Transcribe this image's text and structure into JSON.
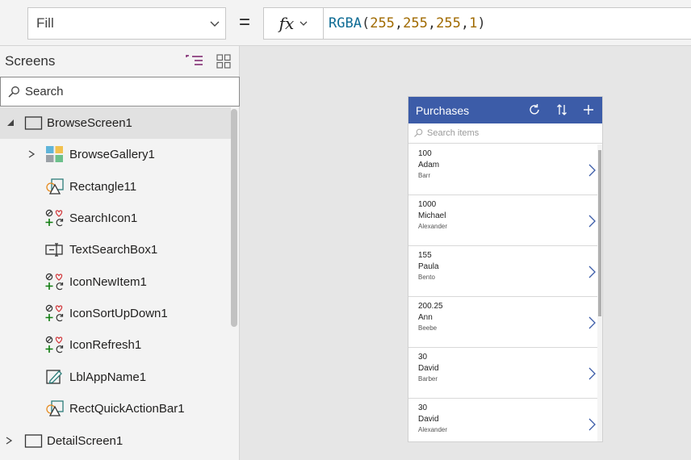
{
  "formula_bar": {
    "property": "Fill",
    "equals": "=",
    "fx_label": "fx",
    "formula_fn": "RGBA",
    "formula_args": [
      "255",
      "255",
      "255",
      "1"
    ]
  },
  "tree": {
    "header": "Screens",
    "search_placeholder": "Search",
    "items": [
      {
        "label": "BrowseScreen1",
        "icon": "screen-icon",
        "expander": "collapse"
      },
      {
        "label": "BrowseGallery1",
        "icon": "gallery-icon",
        "expander": "expand"
      },
      {
        "label": "Rectangle11",
        "icon": "shape-icon",
        "expander": ""
      },
      {
        "label": "SearchIcon1",
        "icon": "icons-control-icon",
        "expander": ""
      },
      {
        "label": "TextSearchBox1",
        "icon": "text-input-icon",
        "expander": ""
      },
      {
        "label": "IconNewItem1",
        "icon": "icons-control-icon",
        "expander": ""
      },
      {
        "label": "IconSortUpDown1",
        "icon": "icons-control-icon",
        "expander": ""
      },
      {
        "label": "IconRefresh1",
        "icon": "icons-control-icon",
        "expander": ""
      },
      {
        "label": "LblAppName1",
        "icon": "label-icon",
        "expander": ""
      },
      {
        "label": "RectQuickActionBar1",
        "icon": "shape-icon",
        "expander": ""
      },
      {
        "label": "DetailScreen1",
        "icon": "screen-icon",
        "expander": "expand"
      }
    ]
  },
  "app": {
    "title": "Purchases",
    "search_placeholder": "Search items",
    "bar_color": "#3c5ca8",
    "items": [
      {
        "value": "100",
        "first": "Adam",
        "last": "Barr"
      },
      {
        "value": "1000",
        "first": "Michael",
        "last": "Alexander"
      },
      {
        "value": "155",
        "first": "Paula",
        "last": "Bento"
      },
      {
        "value": "200.25",
        "first": "Ann",
        "last": "Beebe"
      },
      {
        "value": "30",
        "first": "David",
        "last": "Barber"
      },
      {
        "value": "30",
        "first": "David",
        "last": "Alexander"
      }
    ]
  }
}
